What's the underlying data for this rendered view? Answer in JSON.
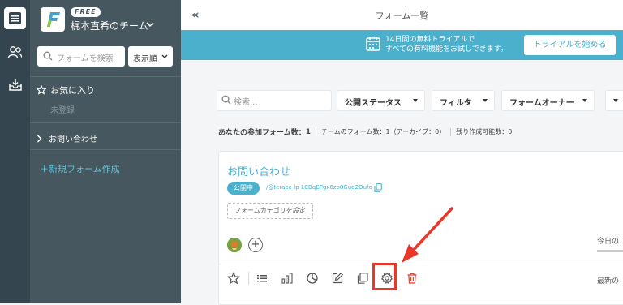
{
  "sidebar": {
    "badge": "FREE",
    "team_name": "梶本直希のチーム",
    "search_placeholder": "フォームを検索",
    "sort_label": "表示順",
    "favorites_label": "お気に入り",
    "favorites_empty": "未登録",
    "folder_label": "お問い合わせ",
    "new_form_label": "＋新規フォーム作成"
  },
  "header": {
    "title": "フォーム一覧"
  },
  "trial": {
    "line1": "14日間の無料トライアルで",
    "line2": "すべての有料機能をお試しできます。",
    "button_label": "トライアルを始める"
  },
  "filters": {
    "search_placeholder": "検索...",
    "status_label": "公開ステータス",
    "filter_label": "フィルタ",
    "owner_label": "フォームオーナー"
  },
  "stats": {
    "joined_label": "あなたの参加フォーム数：",
    "joined_count": "1",
    "team_text": "チームのフォーム数：1（アーカイブ：0）",
    "remaining_text": "残り作成可能数：0"
  },
  "form_card": {
    "title": "お問い合わせ",
    "status": "公開中",
    "url": "/@terace-lp-LCBqEPgx6zo8Guq2Oufo",
    "category_button": "フォームカテゴリを設定",
    "today_label": "今日の",
    "latest_label": "最新の"
  },
  "colors": {
    "accent": "#4bb0cc",
    "highlight": "#e8382a",
    "sidebar": "#46575f",
    "rail": "#354550"
  }
}
